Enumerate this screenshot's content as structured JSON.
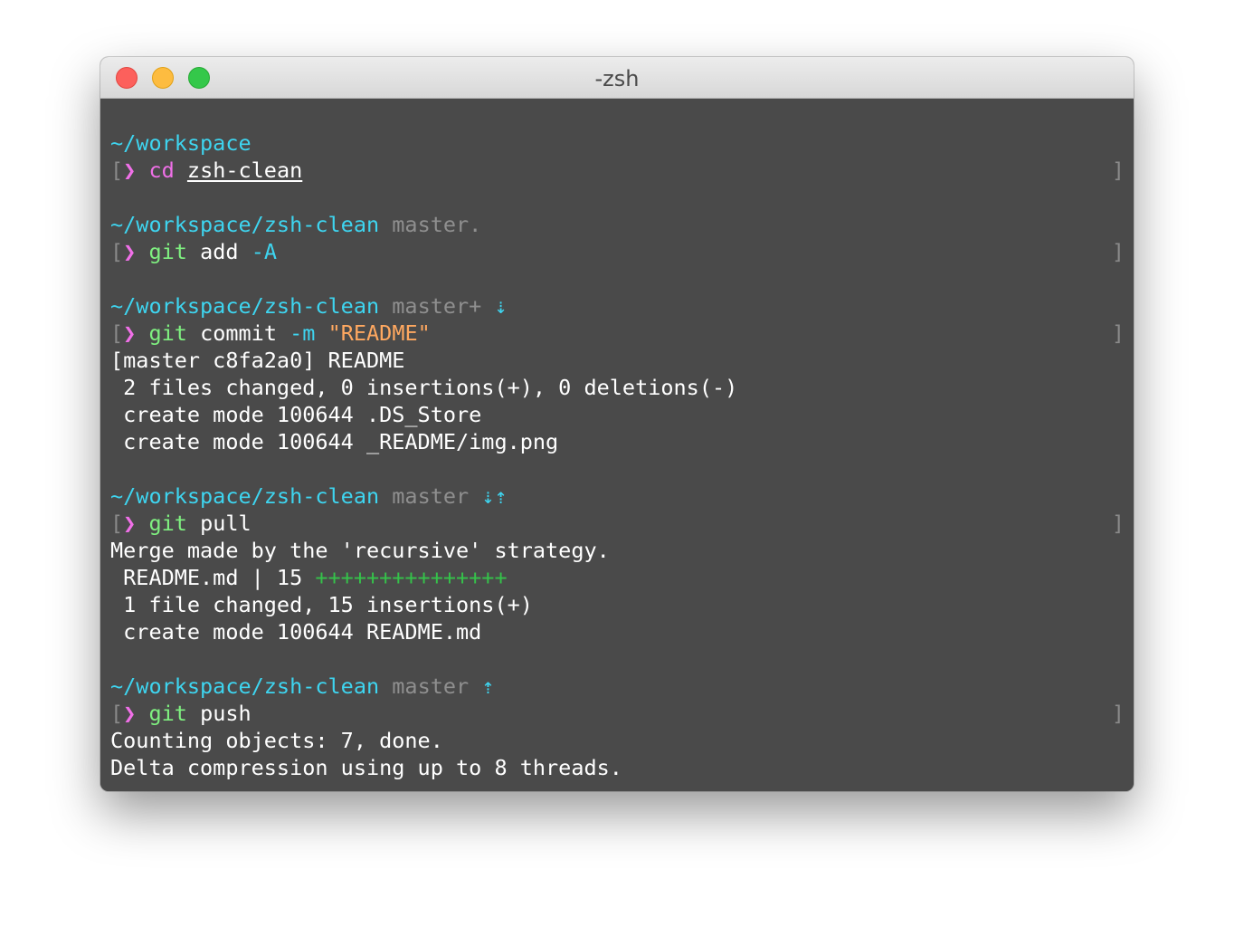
{
  "window": {
    "title": "-zsh"
  },
  "prompt": {
    "symbol": "❯",
    "left_bracket": "[",
    "right_bracket": "]"
  },
  "blocks": {
    "b1": {
      "path": "~/workspace",
      "cmd": "cd",
      "arg": "zsh-clean"
    },
    "b2": {
      "path": "~/workspace/zsh-clean",
      "branch": "master.",
      "cmd": "git",
      "arg1": "add",
      "arg2": "-A"
    },
    "b3": {
      "path": "~/workspace/zsh-clean",
      "branch": "master+",
      "arrows": "⇣",
      "cmd": "git",
      "arg1": "commit",
      "flag": "-m",
      "msg": "\"README\"",
      "output": [
        "[master c8fa2a0] README",
        " 2 files changed, 0 insertions(+), 0 deletions(-)",
        " create mode 100644 .DS_Store",
        " create mode 100644 _README/img.png"
      ]
    },
    "b4": {
      "path": "~/workspace/zsh-clean",
      "branch": "master",
      "arrows": "⇣⇡",
      "cmd": "git",
      "arg1": "pull",
      "out1": "Merge made by the 'recursive' strategy.",
      "stat_file": " README.md | 15 ",
      "stat_plus": "+++++++++++++++",
      "out3": " 1 file changed, 15 insertions(+)",
      "out4": " create mode 100644 README.md"
    },
    "b5": {
      "path": "~/workspace/zsh-clean",
      "branch": "master",
      "arrows": "⇡",
      "cmd": "git",
      "arg1": "push",
      "output": [
        "Counting objects: 7, done.",
        "Delta compression using up to 8 threads."
      ]
    }
  },
  "colors": {
    "background": "#4a4a4a",
    "path": "#3ed5f0",
    "prompt": "#f070e8",
    "command": "#7ff080",
    "branch": "#8f8f8f",
    "string": "#ffa860",
    "diffstat_plus": "#35c24a"
  }
}
